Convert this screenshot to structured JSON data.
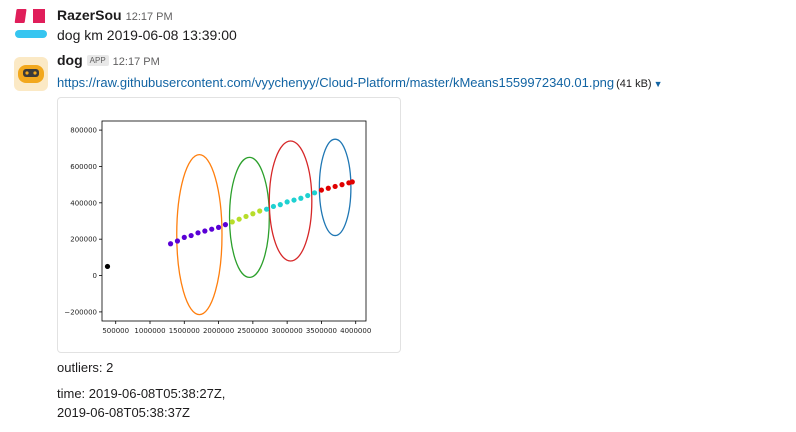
{
  "message1": {
    "sender": "RazerSou",
    "time": "12:17 PM",
    "text": "dog km 2019-06-08 13:39:00",
    "avatar_colors": {
      "top_left": "#e01e5a",
      "top_right": "#e01e5a",
      "bottom": "#36c5f0"
    }
  },
  "message2": {
    "sender": "dog",
    "badge": "APP",
    "time": "12:17 PM",
    "link": "https://raw.githubusercontent.com/vyychenyy/Cloud-Platform/master/kMeans1559972340.01.png",
    "size": "(41 kB)",
    "outliers": "outliers: 2",
    "time_line1": "time: 2019-06-08T05:38:27Z,",
    "time_line2": "2019-06-08T05:38:37Z",
    "avatar_colors": {
      "body": "#f2a81d",
      "face": "#3a3a3a"
    }
  },
  "chart_data": {
    "type": "scatter",
    "xticks": [
      "500000",
      "1000000",
      "1500000",
      "2000000",
      "2500000",
      "3000000",
      "3500000",
      "4000000"
    ],
    "yticks": [
      "−200000",
      "0",
      "200000",
      "400000",
      "600000",
      "800000"
    ],
    "xlim": [
      300000,
      4150000
    ],
    "ylim": [
      -250000,
      850000
    ],
    "points": [
      {
        "x": 380000,
        "y": 50000,
        "color": "#000000"
      },
      {
        "x": 1300000,
        "y": 175000,
        "color": "#5a00d6"
      },
      {
        "x": 1400000,
        "y": 190000,
        "color": "#5a00d6"
      },
      {
        "x": 1500000,
        "y": 210000,
        "color": "#5a00d6"
      },
      {
        "x": 1600000,
        "y": 220000,
        "color": "#5a00d6"
      },
      {
        "x": 1700000,
        "y": 235000,
        "color": "#5a00d6"
      },
      {
        "x": 1800000,
        "y": 245000,
        "color": "#5a00d6"
      },
      {
        "x": 1900000,
        "y": 255000,
        "color": "#5a00d6"
      },
      {
        "x": 2000000,
        "y": 265000,
        "color": "#5a00d6"
      },
      {
        "x": 2100000,
        "y": 280000,
        "color": "#5a00d6"
      },
      {
        "x": 2200000,
        "y": 295000,
        "color": "#b7dd2a"
      },
      {
        "x": 2300000,
        "y": 310000,
        "color": "#b7dd2a"
      },
      {
        "x": 2400000,
        "y": 325000,
        "color": "#b7dd2a"
      },
      {
        "x": 2500000,
        "y": 340000,
        "color": "#b7dd2a"
      },
      {
        "x": 2600000,
        "y": 355000,
        "color": "#b7dd2a"
      },
      {
        "x": 2700000,
        "y": 365000,
        "color": "#1ed1d1"
      },
      {
        "x": 2800000,
        "y": 380000,
        "color": "#1ed1d1"
      },
      {
        "x": 2900000,
        "y": 390000,
        "color": "#1ed1d1"
      },
      {
        "x": 3000000,
        "y": 405000,
        "color": "#1ed1d1"
      },
      {
        "x": 3100000,
        "y": 415000,
        "color": "#1ed1d1"
      },
      {
        "x": 3200000,
        "y": 425000,
        "color": "#1ed1d1"
      },
      {
        "x": 3300000,
        "y": 440000,
        "color": "#1ed1d1"
      },
      {
        "x": 3400000,
        "y": 455000,
        "color": "#1ed1d1"
      },
      {
        "x": 3500000,
        "y": 470000,
        "color": "#e00000"
      },
      {
        "x": 3600000,
        "y": 480000,
        "color": "#e00000"
      },
      {
        "x": 3700000,
        "y": 490000,
        "color": "#e00000"
      },
      {
        "x": 3800000,
        "y": 500000,
        "color": "#e00000"
      },
      {
        "x": 3900000,
        "y": 510000,
        "color": "#e00000"
      },
      {
        "x": 3950000,
        "y": 515000,
        "color": "#e00000"
      }
    ],
    "ellipses": [
      {
        "cx": 1720000,
        "cy": 225000,
        "rx": 330000,
        "ry": 440000,
        "color": "#ff7f0e"
      },
      {
        "cx": 2450000,
        "cy": 320000,
        "rx": 290000,
        "ry": 330000,
        "color": "#2ca02c"
      },
      {
        "cx": 3050000,
        "cy": 410000,
        "rx": 310000,
        "ry": 330000,
        "color": "#d62728"
      },
      {
        "cx": 3700000,
        "cy": 485000,
        "rx": 230000,
        "ry": 265000,
        "color": "#1f77b4"
      }
    ]
  }
}
